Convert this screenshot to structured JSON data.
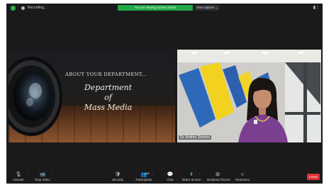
{
  "top_bar": {
    "recording_label": "Recording...",
    "share_banner": "You are viewing Screen Share",
    "view_options_label": "View Options",
    "view_options_caret": "⌄",
    "top_right_icon": "▮⋮"
  },
  "shared_slide": {
    "subtitle": "ABOUT YOUR DEPARTMENT...",
    "title_lines": [
      "Department",
      "of",
      "Mass Media"
    ]
  },
  "video_tile": {
    "participant_name": "Dr. Antima Sharma"
  },
  "toolbar": {
    "unmute": {
      "label": "Unmute",
      "icon": "🎙",
      "caret": "^"
    },
    "stop_video": {
      "label": "Stop Video",
      "icon": "📹",
      "caret": "^"
    },
    "security": {
      "label": "Security",
      "icon": "🛡"
    },
    "participants": {
      "label": "Participants",
      "icon": "👥",
      "count": "49",
      "caret": "^"
    },
    "chat": {
      "label": "Chat",
      "icon": "💬"
    },
    "share_screen": {
      "label": "Share Screen",
      "icon": "⬆",
      "caret": "^"
    },
    "breakout_rooms": {
      "label": "Breakout Rooms",
      "icon": "⊞"
    },
    "reactions": {
      "label": "Reactions",
      "icon": "☺"
    },
    "leave_label": "Leave"
  },
  "colors": {
    "window_bg": "#1a1a1a",
    "share_banner_green": "#22a849",
    "leave_red": "#d8333a"
  }
}
